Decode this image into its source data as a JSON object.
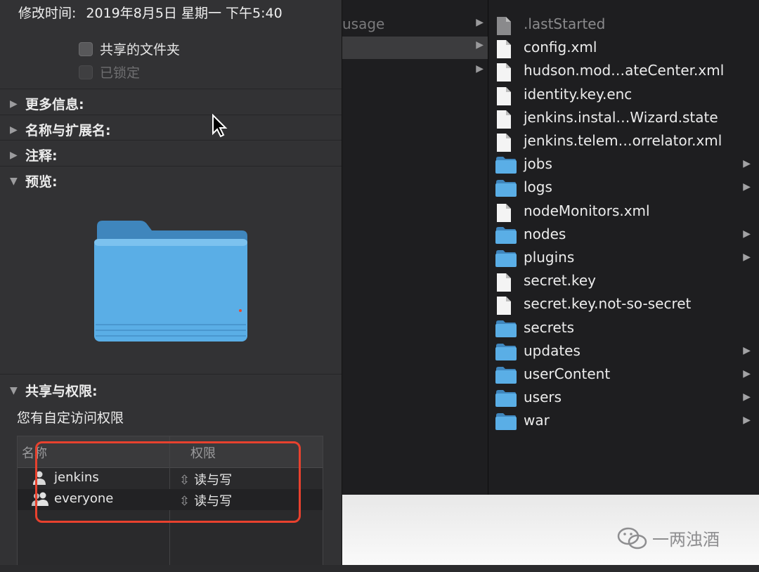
{
  "info_panel": {
    "modified_label": "修改时间:",
    "modified_value": "2019年8月5日 星期一 下午5:40",
    "shared_folder_label": "共享的文件夹",
    "locked_label": "已锁定",
    "sections": {
      "more_info": "更多信息:",
      "name_ext": "名称与扩展名:",
      "comments": "注释:",
      "preview": "预览:",
      "sharing": "共享与权限:"
    },
    "perm_note": "您有自定访问权限",
    "perm_table": {
      "col_name": "名称",
      "col_priv": "权限",
      "rows": [
        {
          "name": "jenkins",
          "privilege": "读与写"
        },
        {
          "name": "everyone",
          "privilege": "读与写"
        }
      ]
    }
  },
  "finder": {
    "prev_column": {
      "first_item": "usage"
    },
    "files": [
      {
        "name": ".lastStarted",
        "kind": "file",
        "dim": true
      },
      {
        "name": "config.xml",
        "kind": "file"
      },
      {
        "name": "hudson.mod…ateCenter.xml",
        "kind": "file"
      },
      {
        "name": "identity.key.enc",
        "kind": "file"
      },
      {
        "name": "jenkins.instal…Wizard.state",
        "kind": "file"
      },
      {
        "name": "jenkins.telem…orrelator.xml",
        "kind": "file"
      },
      {
        "name": "jobs",
        "kind": "folder",
        "has_children": true
      },
      {
        "name": "logs",
        "kind": "folder",
        "has_children": true
      },
      {
        "name": "nodeMonitors.xml",
        "kind": "file"
      },
      {
        "name": "nodes",
        "kind": "folder",
        "has_children": true
      },
      {
        "name": "plugins",
        "kind": "folder",
        "has_children": true
      },
      {
        "name": "secret.key",
        "kind": "file"
      },
      {
        "name": "secret.key.not-so-secret",
        "kind": "file"
      },
      {
        "name": "secrets",
        "kind": "folder",
        "has_children": false
      },
      {
        "name": "updates",
        "kind": "folder",
        "has_children": true
      },
      {
        "name": "userContent",
        "kind": "folder",
        "has_children": true
      },
      {
        "name": "users",
        "kind": "folder",
        "has_children": true
      },
      {
        "name": "war",
        "kind": "folder",
        "has_children": true
      }
    ]
  },
  "watermark": {
    "text": "一两浊酒"
  },
  "colors": {
    "folder": "#5aaee6",
    "highlight": "#e8412e"
  }
}
